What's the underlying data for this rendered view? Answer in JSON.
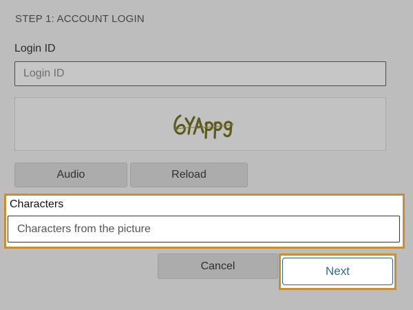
{
  "form": {
    "step_title": "STEP 1: ACCOUNT LOGIN",
    "login_label": "Login ID",
    "login_placeholder": "Login ID",
    "login_value": ""
  },
  "captcha": {
    "icon": "captcha-image",
    "text": "6YAPPg"
  },
  "captcha_buttons": {
    "audio_label": "Audio",
    "reload_label": "Reload"
  },
  "characters": {
    "label": "Characters",
    "placeholder": "Characters from the picture",
    "value": ""
  },
  "actions": {
    "cancel_label": "Cancel",
    "next_label": "Next"
  },
  "colors": {
    "highlight": "#c98e2f",
    "next_text": "#2f6aa0",
    "overlay": "#bdbdbd"
  }
}
